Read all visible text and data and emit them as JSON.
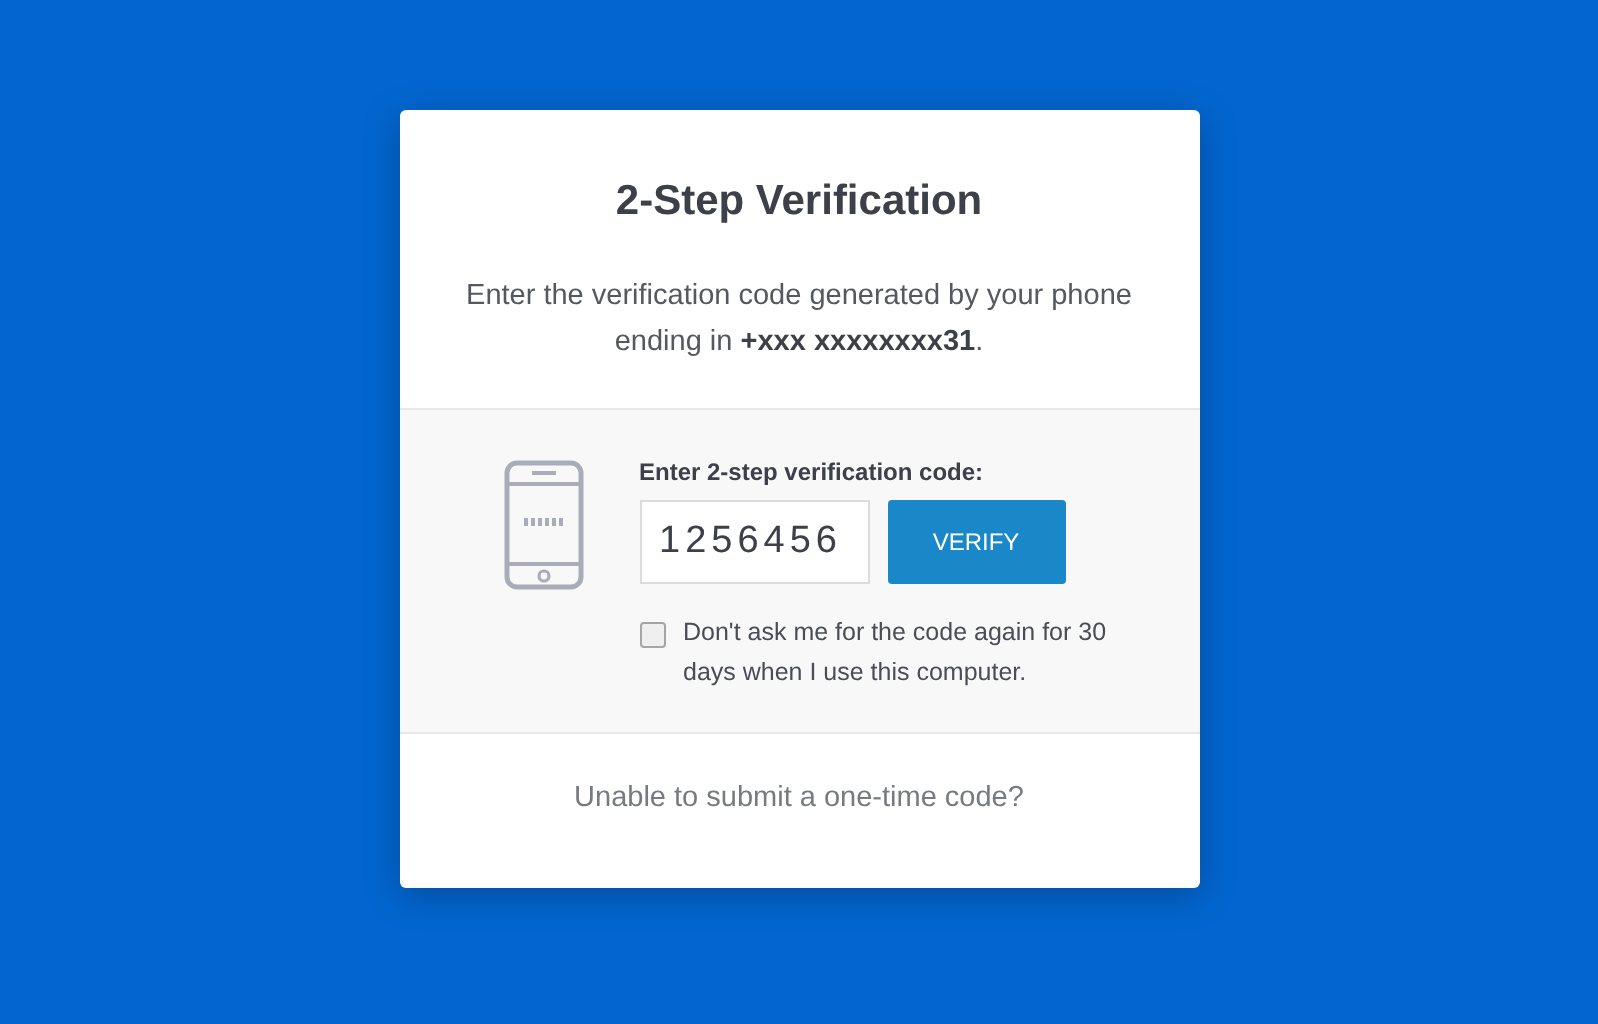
{
  "title": "2-Step Verification",
  "description": "Enter the verification code generated by your phone ending in **+xxx xxxxxxxx31**.",
  "code_label": "Enter 2-step verification code:",
  "code_value": "1256456",
  "verify_button": "VERIFY",
  "remember": {
    "label": "Don't ask me for the code again for 30 days when I use this computer.",
    "checked": false
  },
  "help_link": "Unable to submit a one-time code?"
}
